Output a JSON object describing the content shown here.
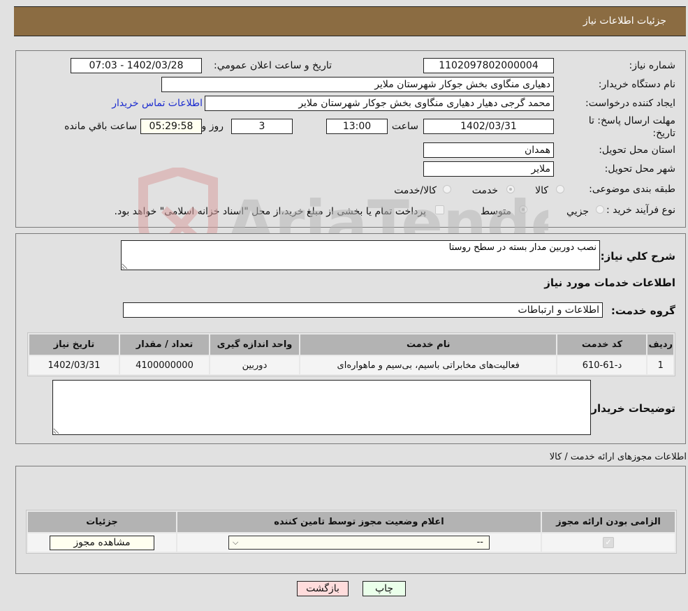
{
  "header": {
    "title": "جزئیات اطلاعات نیاز"
  },
  "details": {
    "need_number_label": "شماره نیاز:",
    "need_number": "1102097802000004",
    "announce_label": "تاريخ و ساعت اعلان عمومي:",
    "announce_value": "1402/03/28 - 07:03",
    "buyer_org_label": "نام دستگاه خريدار:",
    "buyer_org": "دهیاری منگاوی بخش جوکار شهرستان ملایر",
    "creator_label": "ايجاد کننده درخواست:",
    "creator": "محمد گرجی دهیار دهیاری منگاوی بخش جوکار شهرستان ملایر",
    "buyer_contact_link": "اطلاعات تماس خريدار",
    "deadline_label_1": "مهلت ارسال پاسخ: تا",
    "deadline_label_2": "تاريخ:",
    "deadline_date": "1402/03/31",
    "time_label": "ساعت",
    "deadline_time": "13:00",
    "days_value": "3",
    "days_label": "روز و",
    "remaining_value": "05:29:58",
    "remaining_label": "ساعت باقي مانده",
    "province_label": "استان محل تحویل:",
    "province": "همدان",
    "city_label": "شهر محل تحویل:",
    "city": "ملاير",
    "category_label": "طبقه بندی موضوعی:",
    "category_options": [
      "کالا",
      "خدمت",
      "کالا/خدمت"
    ],
    "category_selected": "خدمت",
    "process_label": "نوع فرآيند خريد :",
    "process_options": [
      "جزيي",
      "متوسط"
    ],
    "process_selected": "متوسط",
    "treasury_note": "پرداخت تمام يا بخشی از مبلغ خريد،از محل \"اسناد خزانه اسلامی\" خواهد بود."
  },
  "summary": {
    "description_label": "شرح کلي نياز:",
    "description": "نصب دوربین مدار بسته در سطح روستا",
    "services_heading": "اطلاعات خدمات مورد نیاز",
    "service_group_label": "گروه خدمت:",
    "service_group": "اطلاعات و ارتباطات",
    "table": {
      "headers": [
        "رديف",
        "کد خدمت",
        "نام خدمت",
        "واحد اندازه گيری",
        "تعداد / مقدار",
        "تاريخ نياز"
      ],
      "rows": [
        [
          "1",
          "د-61-610",
          "فعالیت‌های مخابراتی باسیم، بی‌سیم و ماهواره‌ای",
          "دوربین",
          "4100000000",
          "1402/03/31"
        ]
      ]
    },
    "buyer_notes_label": "توضيحات خريدار:",
    "buyer_notes": ""
  },
  "permits": {
    "heading": "اطلاعات مجوزهای ارائه خدمت / کالا",
    "headers": [
      "الزامی بودن ارائه مجوز",
      "اعلام وضعیت مجوز توسط تامین کننده",
      "جزئيات"
    ],
    "row": {
      "required_checked": true,
      "status_value": "--",
      "details_button": "مشاهده مجوز"
    }
  },
  "footer": {
    "print_button": "چاپ",
    "back_button": "بازگشت"
  },
  "watermark": {
    "text": "AriaTender.neT"
  },
  "colors": {
    "header_bg": "#8b6c42",
    "print_bg": "#eaffea",
    "back_bg": "#ffdcdc",
    "link": "#1c2ccf"
  }
}
